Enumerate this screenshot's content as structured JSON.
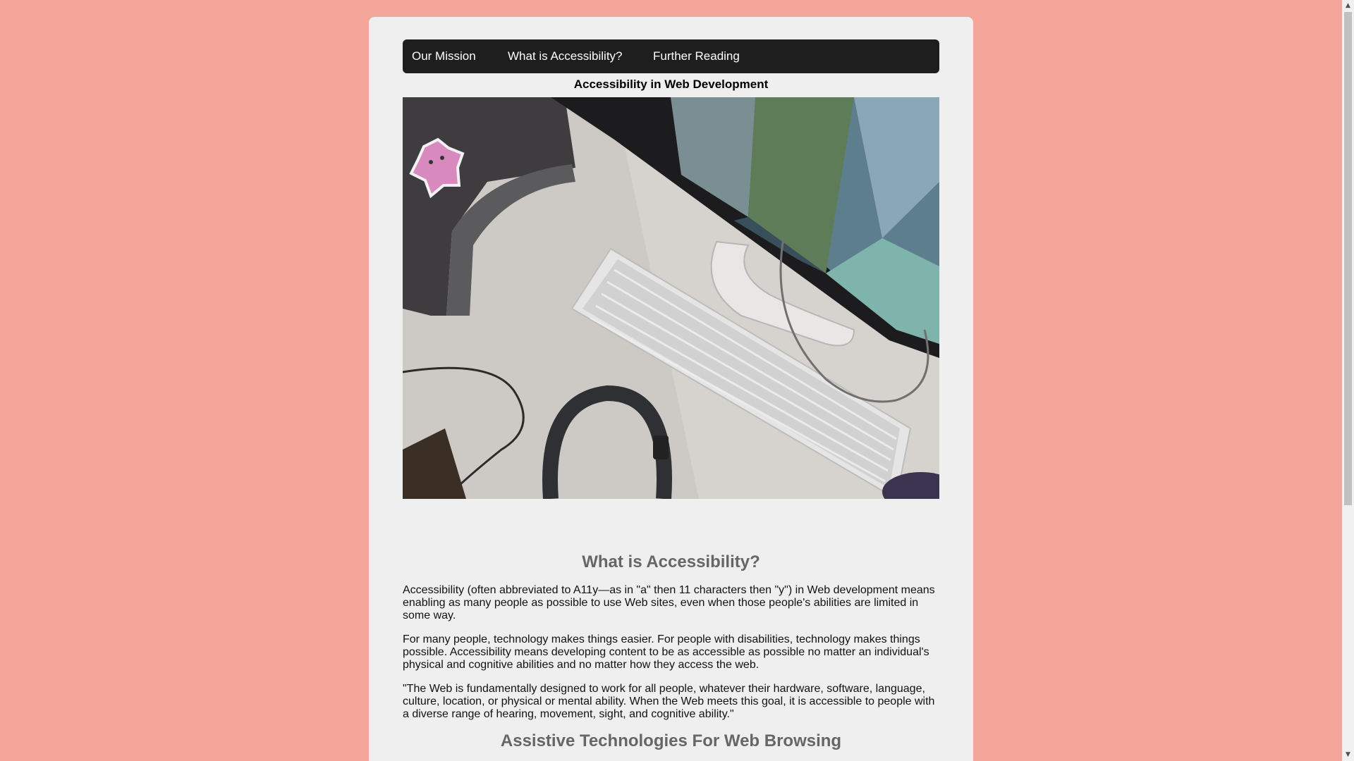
{
  "nav": {
    "items": [
      {
        "label": "Our Mission"
      },
      {
        "label": "What is Accessibility?"
      },
      {
        "label": "Further Reading"
      }
    ]
  },
  "page_title": "Accessibility in Web Development",
  "hero": {
    "icon": "desk-workspace-photo"
  },
  "section1": {
    "heading": "What is Accessibility?",
    "paragraphs": [
      "Accessibility (often abbreviated to A11y—as in \"a\" then 11 characters then \"y\") in Web development means enabling as many people as possible to use Web sites, even when those people's abilities are limited in some way.",
      "For many people, technology makes things easier. For people with disabilities, technology makes things possible. Accessibility means developing content to be as accessible as possible no matter an individual's physical and cognitive abilities and no matter how they access the web.",
      "\"The Web is fundamentally designed to work for all people, whatever their hardware, software, language, culture, location, or physical or mental ability. When the Web meets this goal, it is accessible to people with a diverse range of hearing, movement, sight, and cognitive ability.\""
    ]
  },
  "section2": {
    "heading": "Assistive Technologies For Web Browsing"
  },
  "scrollbar": {
    "up_icon": "scroll-up-arrow-icon",
    "down_icon": "scroll-down-arrow-icon"
  },
  "colors": {
    "background": "#f4a69a",
    "card": "#efefef",
    "navbar": "#1e1e1e",
    "heading": "#666666"
  }
}
